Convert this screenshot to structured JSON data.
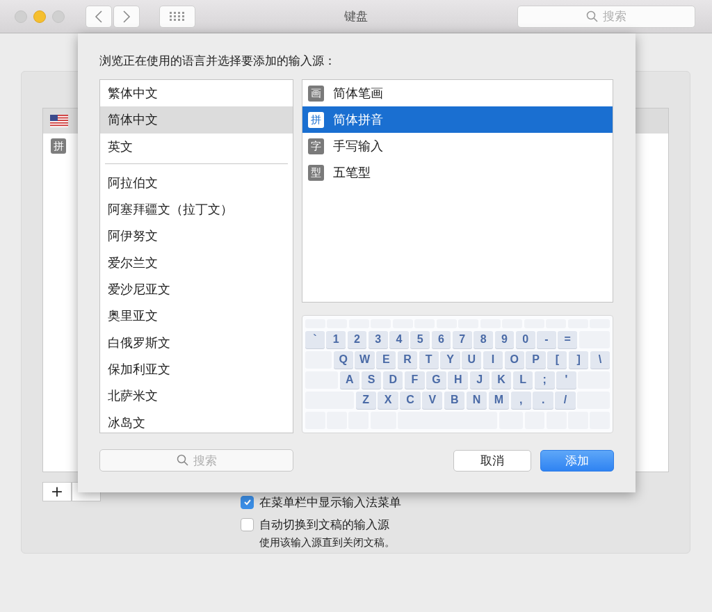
{
  "window": {
    "title": "键盘",
    "search_placeholder": "搜索"
  },
  "background": {
    "sources": [
      {
        "kind": "flag",
        "selected": true
      },
      {
        "kind": "glyph",
        "glyph": "拼",
        "selected": false
      }
    ],
    "add_button": "+",
    "options": [
      {
        "label": "在菜单栏中显示输入法菜单",
        "checked": true
      },
      {
        "label": "自动切换到文稿的输入源",
        "checked": false,
        "note": "使用该输入源直到关闭文稿。"
      }
    ]
  },
  "sheet": {
    "heading": "浏览正在使用的语言并选择要添加的输入源：",
    "languages": [
      [
        {
          "label": "繁体中文",
          "selected": false
        },
        {
          "label": "简体中文",
          "selected": true
        },
        {
          "label": "英文",
          "selected": false
        }
      ],
      [
        {
          "label": "阿拉伯文",
          "selected": false
        },
        {
          "label": "阿塞拜疆文（拉丁文）",
          "selected": false
        },
        {
          "label": "阿伊努文",
          "selected": false
        },
        {
          "label": "爱尔兰文",
          "selected": false
        },
        {
          "label": "爱沙尼亚文",
          "selected": false
        },
        {
          "label": "奥里亚文",
          "selected": false
        },
        {
          "label": "白俄罗斯文",
          "selected": false
        },
        {
          "label": "保加利亚文",
          "selected": false
        },
        {
          "label": "北萨米文",
          "selected": false
        },
        {
          "label": "冰岛文",
          "selected": false
        }
      ]
    ],
    "input_sources": [
      {
        "icon": "画",
        "label": "简体笔画",
        "selected": false
      },
      {
        "icon": "拼",
        "label": "简体拼音",
        "selected": true
      },
      {
        "icon": "字",
        "label": "手写输入",
        "selected": false
      },
      {
        "icon": "型",
        "label": "五笔型",
        "selected": false
      }
    ],
    "keyboard": [
      [
        "`",
        "1",
        "2",
        "3",
        "4",
        "5",
        "6",
        "7",
        "8",
        "9",
        "0",
        "-",
        "="
      ],
      [
        "Q",
        "W",
        "E",
        "R",
        "T",
        "Y",
        "U",
        "I",
        "O",
        "P",
        "[",
        "]",
        "\\"
      ],
      [
        "A",
        "S",
        "D",
        "F",
        "G",
        "H",
        "J",
        "K",
        "L",
        ";",
        "'"
      ],
      [
        "Z",
        "X",
        "C",
        "V",
        "B",
        "N",
        "M",
        ",",
        ".",
        "/"
      ]
    ],
    "search_placeholder": "搜索",
    "buttons": [
      {
        "label": "取消",
        "kind": "default"
      },
      {
        "label": "添加",
        "kind": "primary"
      }
    ]
  }
}
